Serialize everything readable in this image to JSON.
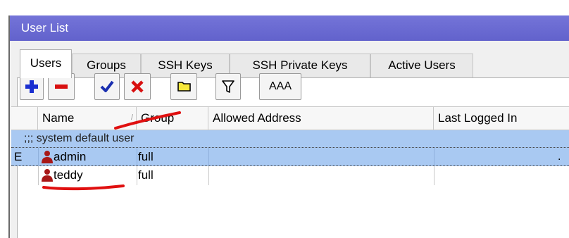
{
  "window": {
    "title": "User List"
  },
  "tabs": [
    {
      "label": "Users",
      "active": true
    },
    {
      "label": "Groups",
      "active": false
    },
    {
      "label": "SSH Keys",
      "active": false
    },
    {
      "label": "SSH Private Keys",
      "active": false
    },
    {
      "label": "Active Users",
      "active": false
    }
  ],
  "toolbar": {
    "add_icon": "plus-icon",
    "remove_icon": "minus-icon",
    "enable_icon": "check-icon",
    "disable_icon": "x-icon",
    "comment_icon": "comment-icon",
    "filter_icon": "filter-icon",
    "aaa_label": "AAA"
  },
  "table": {
    "columns": [
      "",
      "Name",
      "Group",
      "Allowed Address",
      "Last Logged In"
    ],
    "group_comment": ";;; system default user",
    "rows": [
      {
        "flag": "E",
        "name": "admin",
        "group": "full",
        "selected": true
      },
      {
        "flag": "",
        "name": "teddy",
        "group": "full",
        "selected": false
      }
    ]
  },
  "colors": {
    "titlebar": "#6b6bd3",
    "selection": "#a9c9f2",
    "annotation": "#e01010",
    "add": "#1a2fd0",
    "remove": "#d81010",
    "user_icon": "#a81818"
  }
}
